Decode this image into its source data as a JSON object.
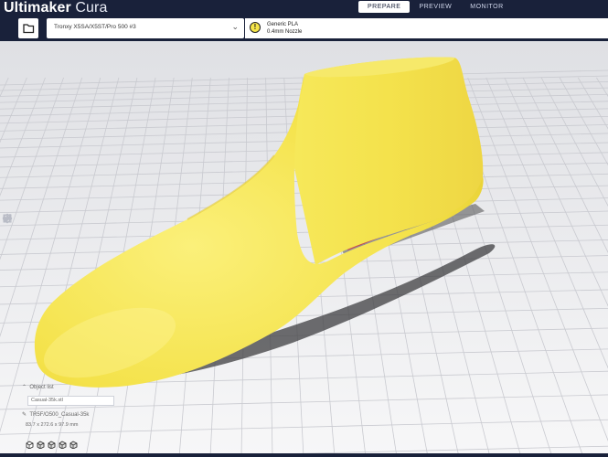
{
  "app": {
    "brand_bold": "Ultimaker",
    "brand_light": " Cura"
  },
  "stages": [
    {
      "label": "PREPARE",
      "active": true
    },
    {
      "label": "PREVIEW",
      "active": false
    },
    {
      "label": "MONITOR",
      "active": false
    }
  ],
  "toolbar": {
    "open_icon": "folder-icon",
    "machine_name": "Tronxy X5SA/X5ST/Pro 500 #3",
    "machine_chevron": "⌄",
    "material_warning_icon": "!",
    "material_name": "Generic PLA",
    "nozzle": "0.4mm Nozzle"
  },
  "tools": [
    "move-icon",
    "scale-icon",
    "rotate-icon",
    "mirror-icon",
    "per-model-settings-icon",
    "support-blocker-icon"
  ],
  "object_panel": {
    "header": "Object list",
    "file": "Casual-35k.stl",
    "job_name": "TR5F/O500_Casual-35k",
    "dimensions": "83.7 x 272.6 x 97.9 mm"
  },
  "view_buttons": [
    "3d-view-icon",
    "front-view-icon",
    "top-view-icon",
    "left-view-icon",
    "right-view-icon"
  ],
  "colors": {
    "header": "#19213a",
    "model": "#f5e44e",
    "grid": "#c9cad0",
    "accent": "#196ef0"
  }
}
